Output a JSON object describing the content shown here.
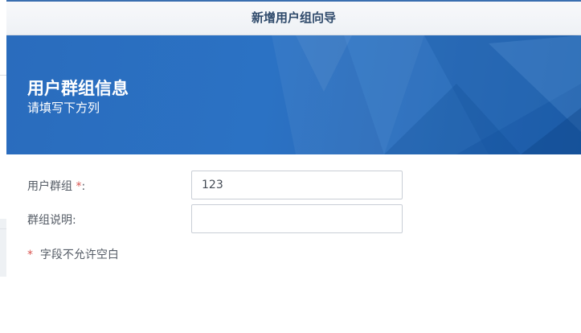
{
  "dialog": {
    "title": "新增用户组向导"
  },
  "banner": {
    "heading": "用户群组信息",
    "subheading": "请填写下方列"
  },
  "form": {
    "group_label": "用户群组",
    "group_required_mark": "*",
    "group_colon": ":",
    "group_value": "123",
    "desc_label": "群组说明:",
    "desc_value": ""
  },
  "note": {
    "mark": "*",
    "text": "字段不允许空白"
  },
  "colors": {
    "accent": "#2a6cbd",
    "title_text": "#2f4a6b",
    "required": "#d9534f"
  }
}
